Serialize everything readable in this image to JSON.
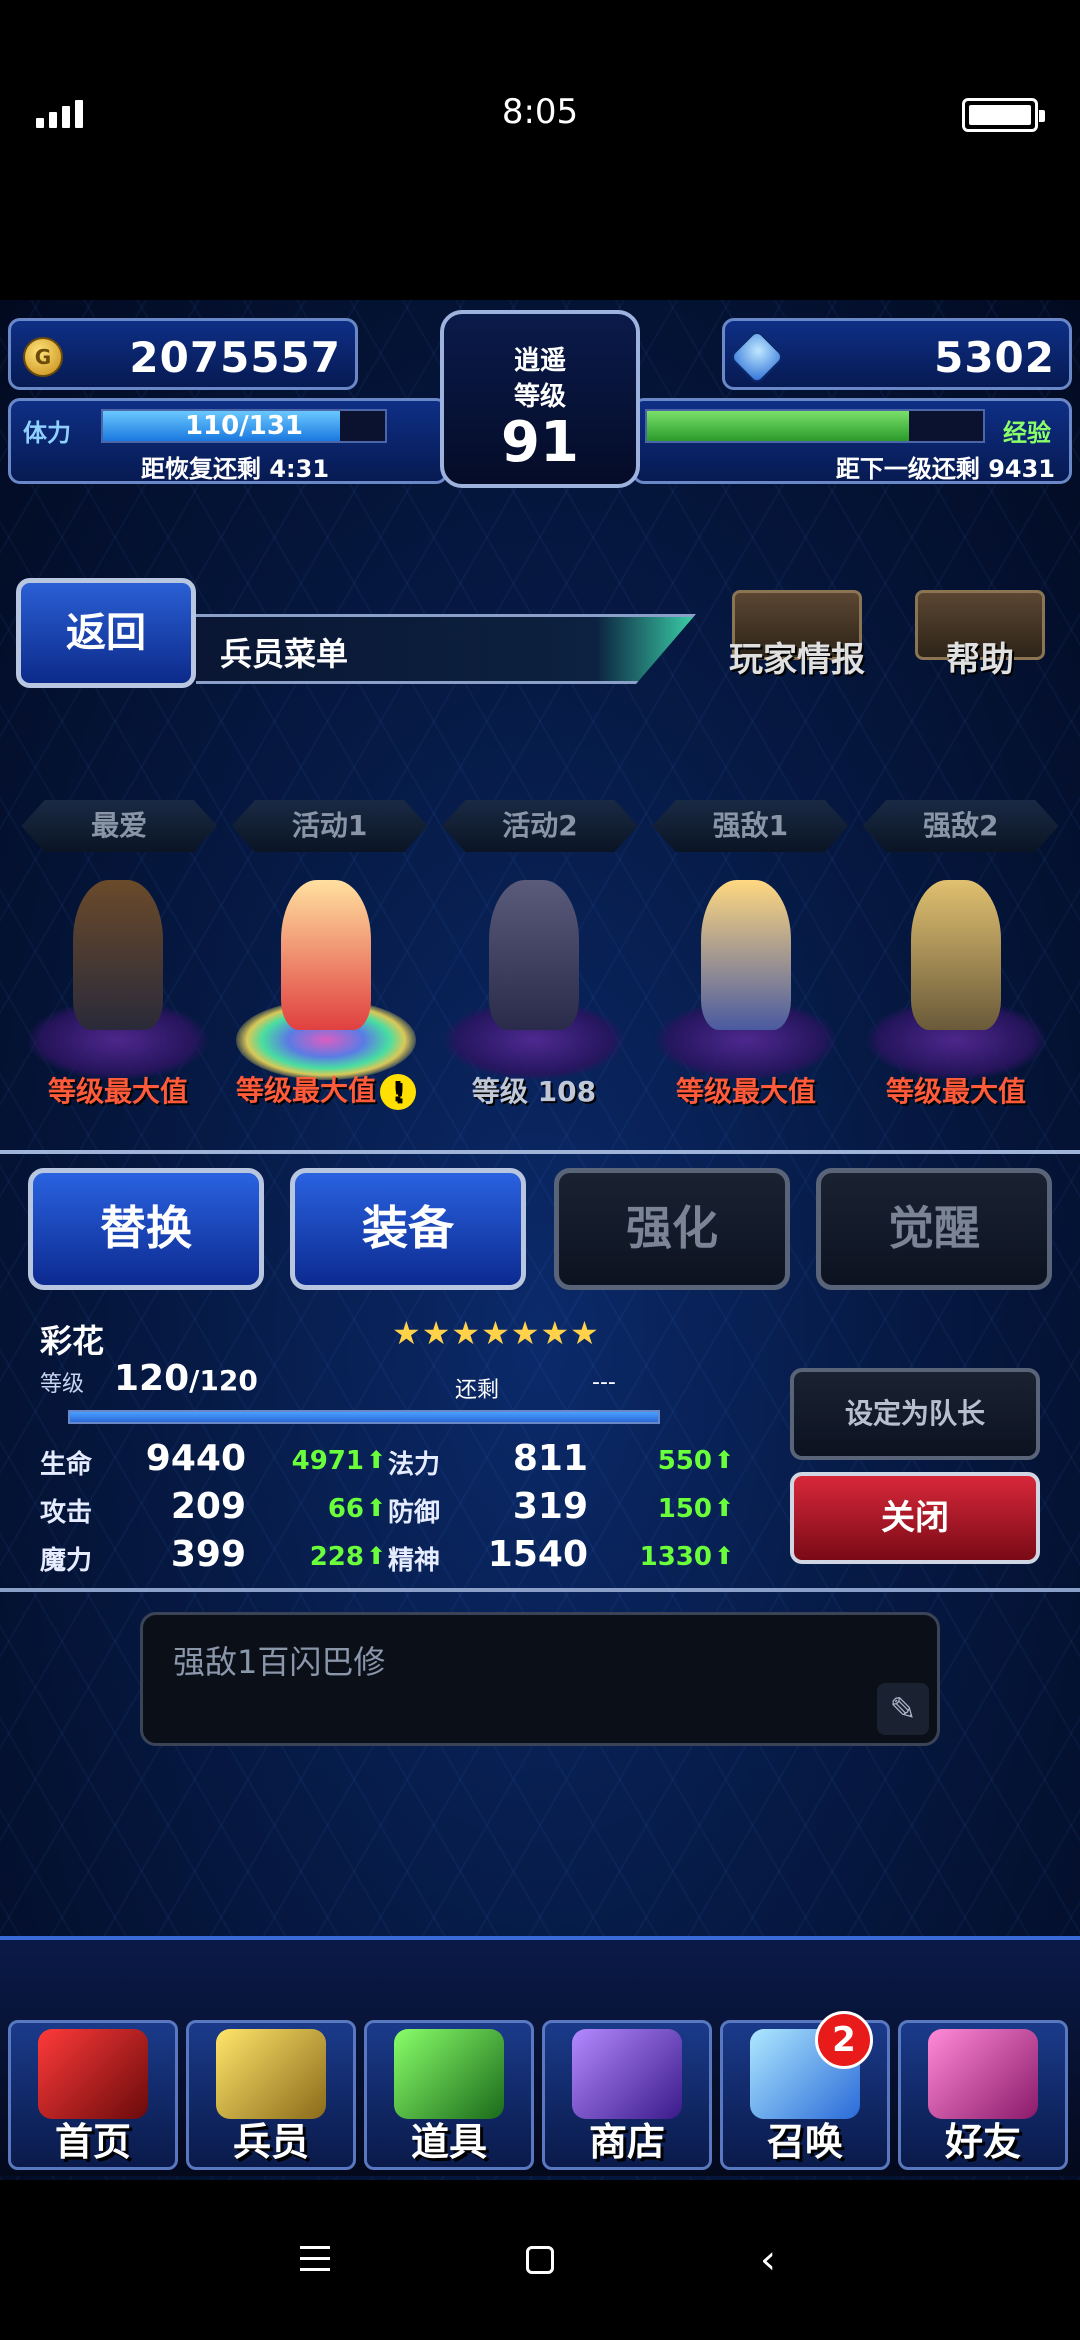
{
  "status_bar": {
    "time": "8:05"
  },
  "hud": {
    "gil": "2075557",
    "gems": "5302",
    "title_line1": "逍遥",
    "title_line2": "等级",
    "level": "91",
    "stamina_label": "体力",
    "stamina_value": "110/131",
    "stamina_fraction": 0.84,
    "stamina_recover": "距恢复还剩 4:31",
    "exp_label": "经验",
    "exp_fraction": 0.78,
    "exp_next": "距下一级还剩 9431"
  },
  "menu": {
    "back_label": "返回",
    "title": "兵员菜单",
    "player_info_label": "玩家情报",
    "help_label": "帮助"
  },
  "party_tabs": [
    "最爱",
    "活动1",
    "活动2",
    "强敌1",
    "强敌2"
  ],
  "units": [
    {
      "label": "等级最大值"
    },
    {
      "label": "等级最大值",
      "warning": "!"
    },
    {
      "label": "等级 108"
    },
    {
      "label": "等级最大值"
    },
    {
      "label": "等级最大值"
    }
  ],
  "actions": [
    "替换",
    "装备",
    "强化",
    "觉醒"
  ],
  "detail": {
    "name": "彩花",
    "stars": "★★★★★★★",
    "level_label": "等级",
    "level_current": "120",
    "level_max": "/120",
    "remain_label": "还剩",
    "remain_value": "---",
    "exp_fraction": 1.0,
    "stats": [
      {
        "k1": "生命",
        "v1": "9440",
        "b1": "4971",
        "k2": "法力",
        "v2": "811",
        "b2": "550"
      },
      {
        "k1": "攻击",
        "v1": "209",
        "b1": "66",
        "k2": "防御",
        "v2": "319",
        "b2": "150"
      },
      {
        "k1": "魔力",
        "v1": "399",
        "b1": "228",
        "k2": "精神",
        "v2": "1540",
        "b2": "1330"
      }
    ],
    "leader_label": "设定为队长",
    "close_label": "关闭",
    "note": "强敌1百闪巴修"
  },
  "nav": {
    "items": [
      "首页",
      "兵员",
      "道具",
      "商店",
      "召唤",
      "好友"
    ],
    "summon_badge": "2"
  },
  "colors": {
    "accent": "#2a62e0",
    "bonus": "#6aff3a",
    "warning": "#ff5a3a",
    "close": "#d8283a"
  }
}
